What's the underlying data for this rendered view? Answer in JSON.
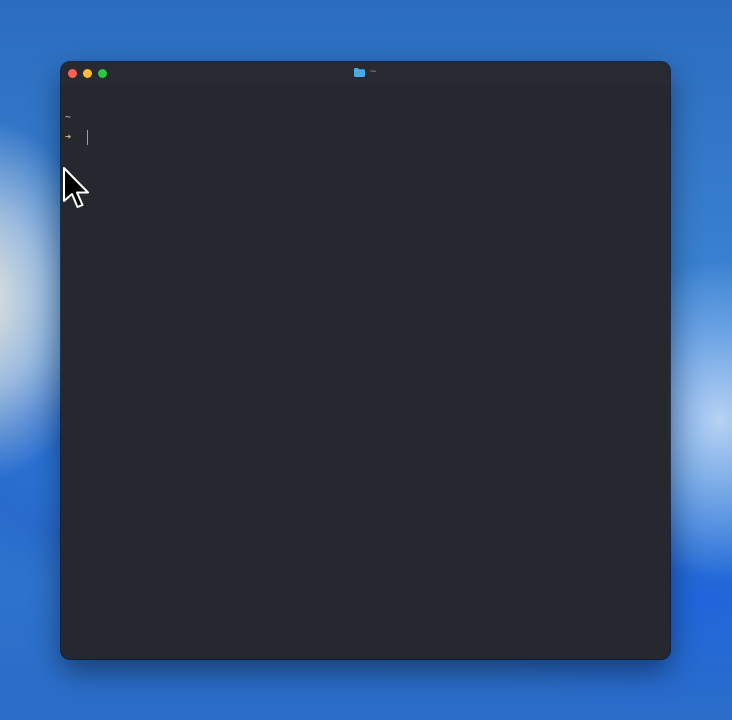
{
  "window": {
    "title": "~",
    "title_icon": "folder-icon",
    "traffic_lights": [
      {
        "name": "close",
        "color": "#ff5f57"
      },
      {
        "name": "minimize",
        "color": "#febc2e"
      },
      {
        "name": "zoom",
        "color": "#28c840"
      }
    ]
  },
  "terminal": {
    "cwd": "~",
    "prompt_symbol": "➜",
    "input_value": "",
    "colors": {
      "background": "#25282f",
      "prompt": "#e5c07b",
      "text": "#c9ccd3"
    }
  },
  "pointer": {
    "icon": "mouse-pointer-icon"
  }
}
